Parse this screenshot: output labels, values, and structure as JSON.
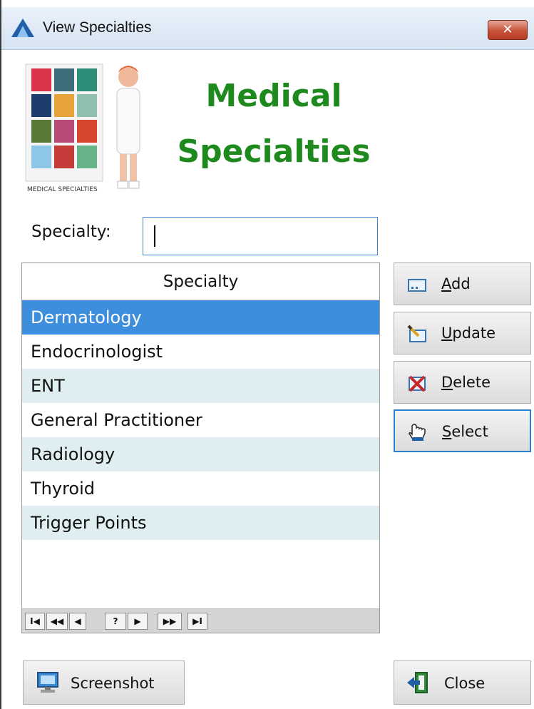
{
  "window": {
    "title": "View Specialties",
    "close_glyph": "✕"
  },
  "header": {
    "heading_line1": "Medical",
    "heading_line2": "Specialties",
    "logo_caption": "MEDICAL SPECIALTIES",
    "heading_color": "#1e8a1e"
  },
  "search": {
    "label": "Specialty:",
    "value": ""
  },
  "grid": {
    "column_header": "Specialty",
    "rows": [
      "Dermatology",
      "Endocrinologist",
      "ENT",
      "General Practitioner",
      "Radiology",
      "Thyroid",
      "Trigger Points"
    ],
    "selected_index": 0,
    "selected_color": "#3e8ede",
    "alt_row_color": "#dfeef0"
  },
  "navigator": {
    "first": "I◀",
    "prev_page": "◀◀",
    "prev": "◀",
    "find": "?",
    "next": "▶",
    "next_page": "▶▶",
    "last": "▶I"
  },
  "buttons": {
    "add": {
      "mnemonic": "A",
      "rest": "dd",
      "icon": "add-record-icon"
    },
    "update": {
      "mnemonic": "U",
      "rest": "pdate",
      "icon": "edit-pencil-icon"
    },
    "delete": {
      "mnemonic": "D",
      "rest": "elete",
      "icon": "delete-x-icon"
    },
    "select": {
      "mnemonic": "S",
      "rest": "elect",
      "icon": "pointing-hand-icon"
    },
    "screenshot": {
      "label": "Screenshot",
      "icon": "monitor-icon"
    },
    "close": {
      "label": "Close",
      "icon": "exit-door-icon"
    }
  }
}
